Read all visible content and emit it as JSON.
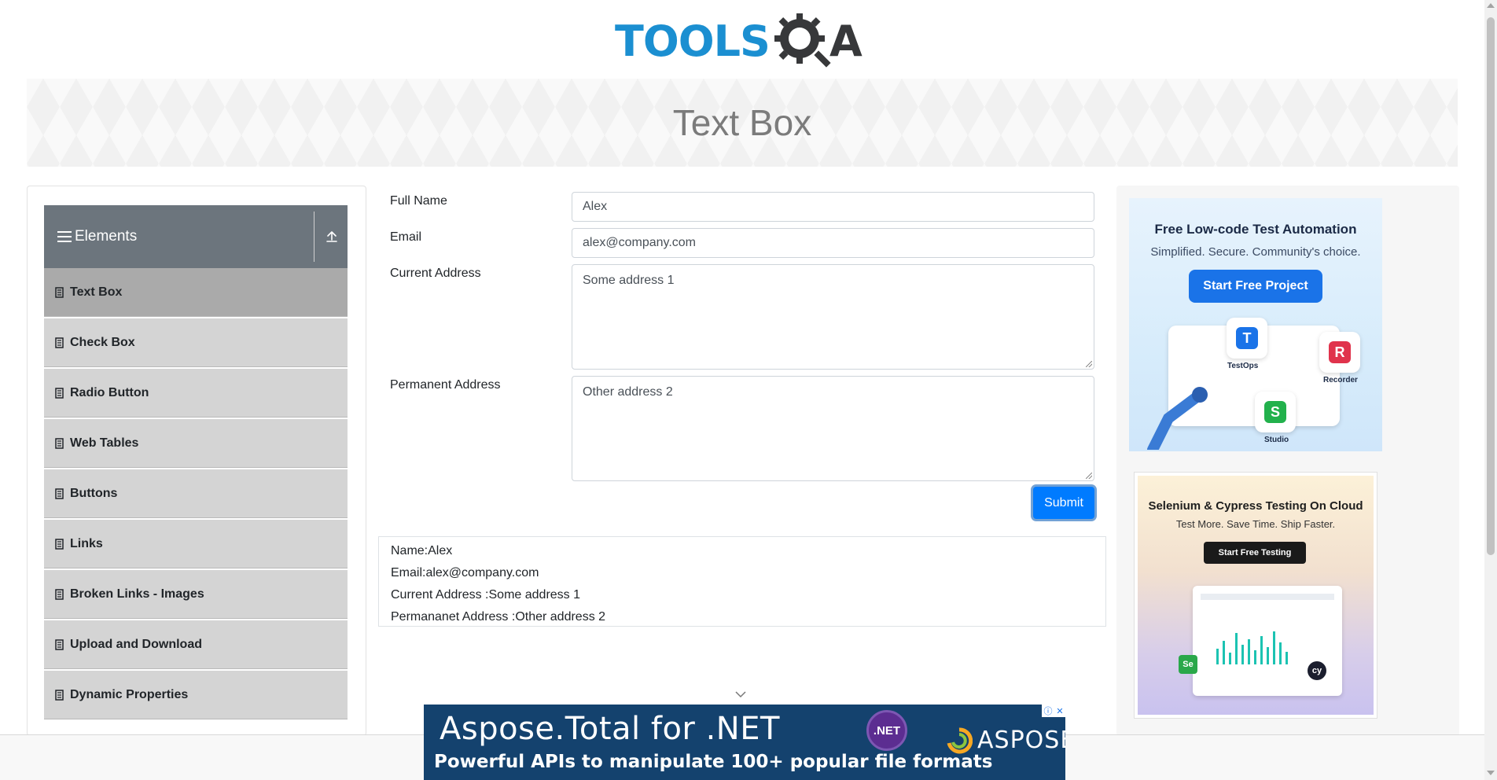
{
  "header": {
    "logo_text_left": "TOOLS",
    "logo_text_right": "A",
    "brand_color": "#1b8fd1"
  },
  "banner": {
    "title": "Text Box"
  },
  "sidebar": {
    "group_title": "Elements",
    "group_icon": "menu-icon",
    "collapse_icon": "upload-arrow-icon",
    "items": [
      {
        "label": "Text Box",
        "active": true
      },
      {
        "label": "Check Box"
      },
      {
        "label": "Radio Button"
      },
      {
        "label": "Web Tables"
      },
      {
        "label": "Buttons"
      },
      {
        "label": "Links"
      },
      {
        "label": "Broken Links - Images"
      },
      {
        "label": "Upload and Download"
      },
      {
        "label": "Dynamic Properties"
      }
    ]
  },
  "form": {
    "full_name": {
      "label": "Full Name",
      "value": "Alex"
    },
    "email": {
      "label": "Email",
      "value": "alex@company.com"
    },
    "current_address": {
      "label": "Current Address",
      "value": "Some address 1"
    },
    "permanent_address": {
      "label": "Permanent Address",
      "value": "Other address 2"
    },
    "submit_label": "Submit",
    "accent_color": "#007bff"
  },
  "output": {
    "name": "Name:Alex",
    "email": "Email:alex@company.com",
    "current_address": "Current Address :Some address 1",
    "permanent_address": "Permananet Address :Other address 2"
  },
  "ads": {
    "ad1": {
      "title": "Free Low-code Test Automation",
      "subtitle": "Simplified. Secure. Community's choice.",
      "button": "Start Free Project",
      "labels": [
        "TestOps",
        "Recorder",
        "Studio"
      ]
    },
    "ad2": {
      "title": "Selenium & Cypress Testing On Cloud",
      "subtitle": "Test More. Save Time. Ship Faster.",
      "button": "Start Free Testing"
    },
    "ad3": {
      "line1": "Aspose.Total for .NET",
      "line2": "Powerful APIs to manipulate 100+ popular file formats",
      "net_badge": ".NET",
      "brand": "ASPOSE"
    }
  }
}
